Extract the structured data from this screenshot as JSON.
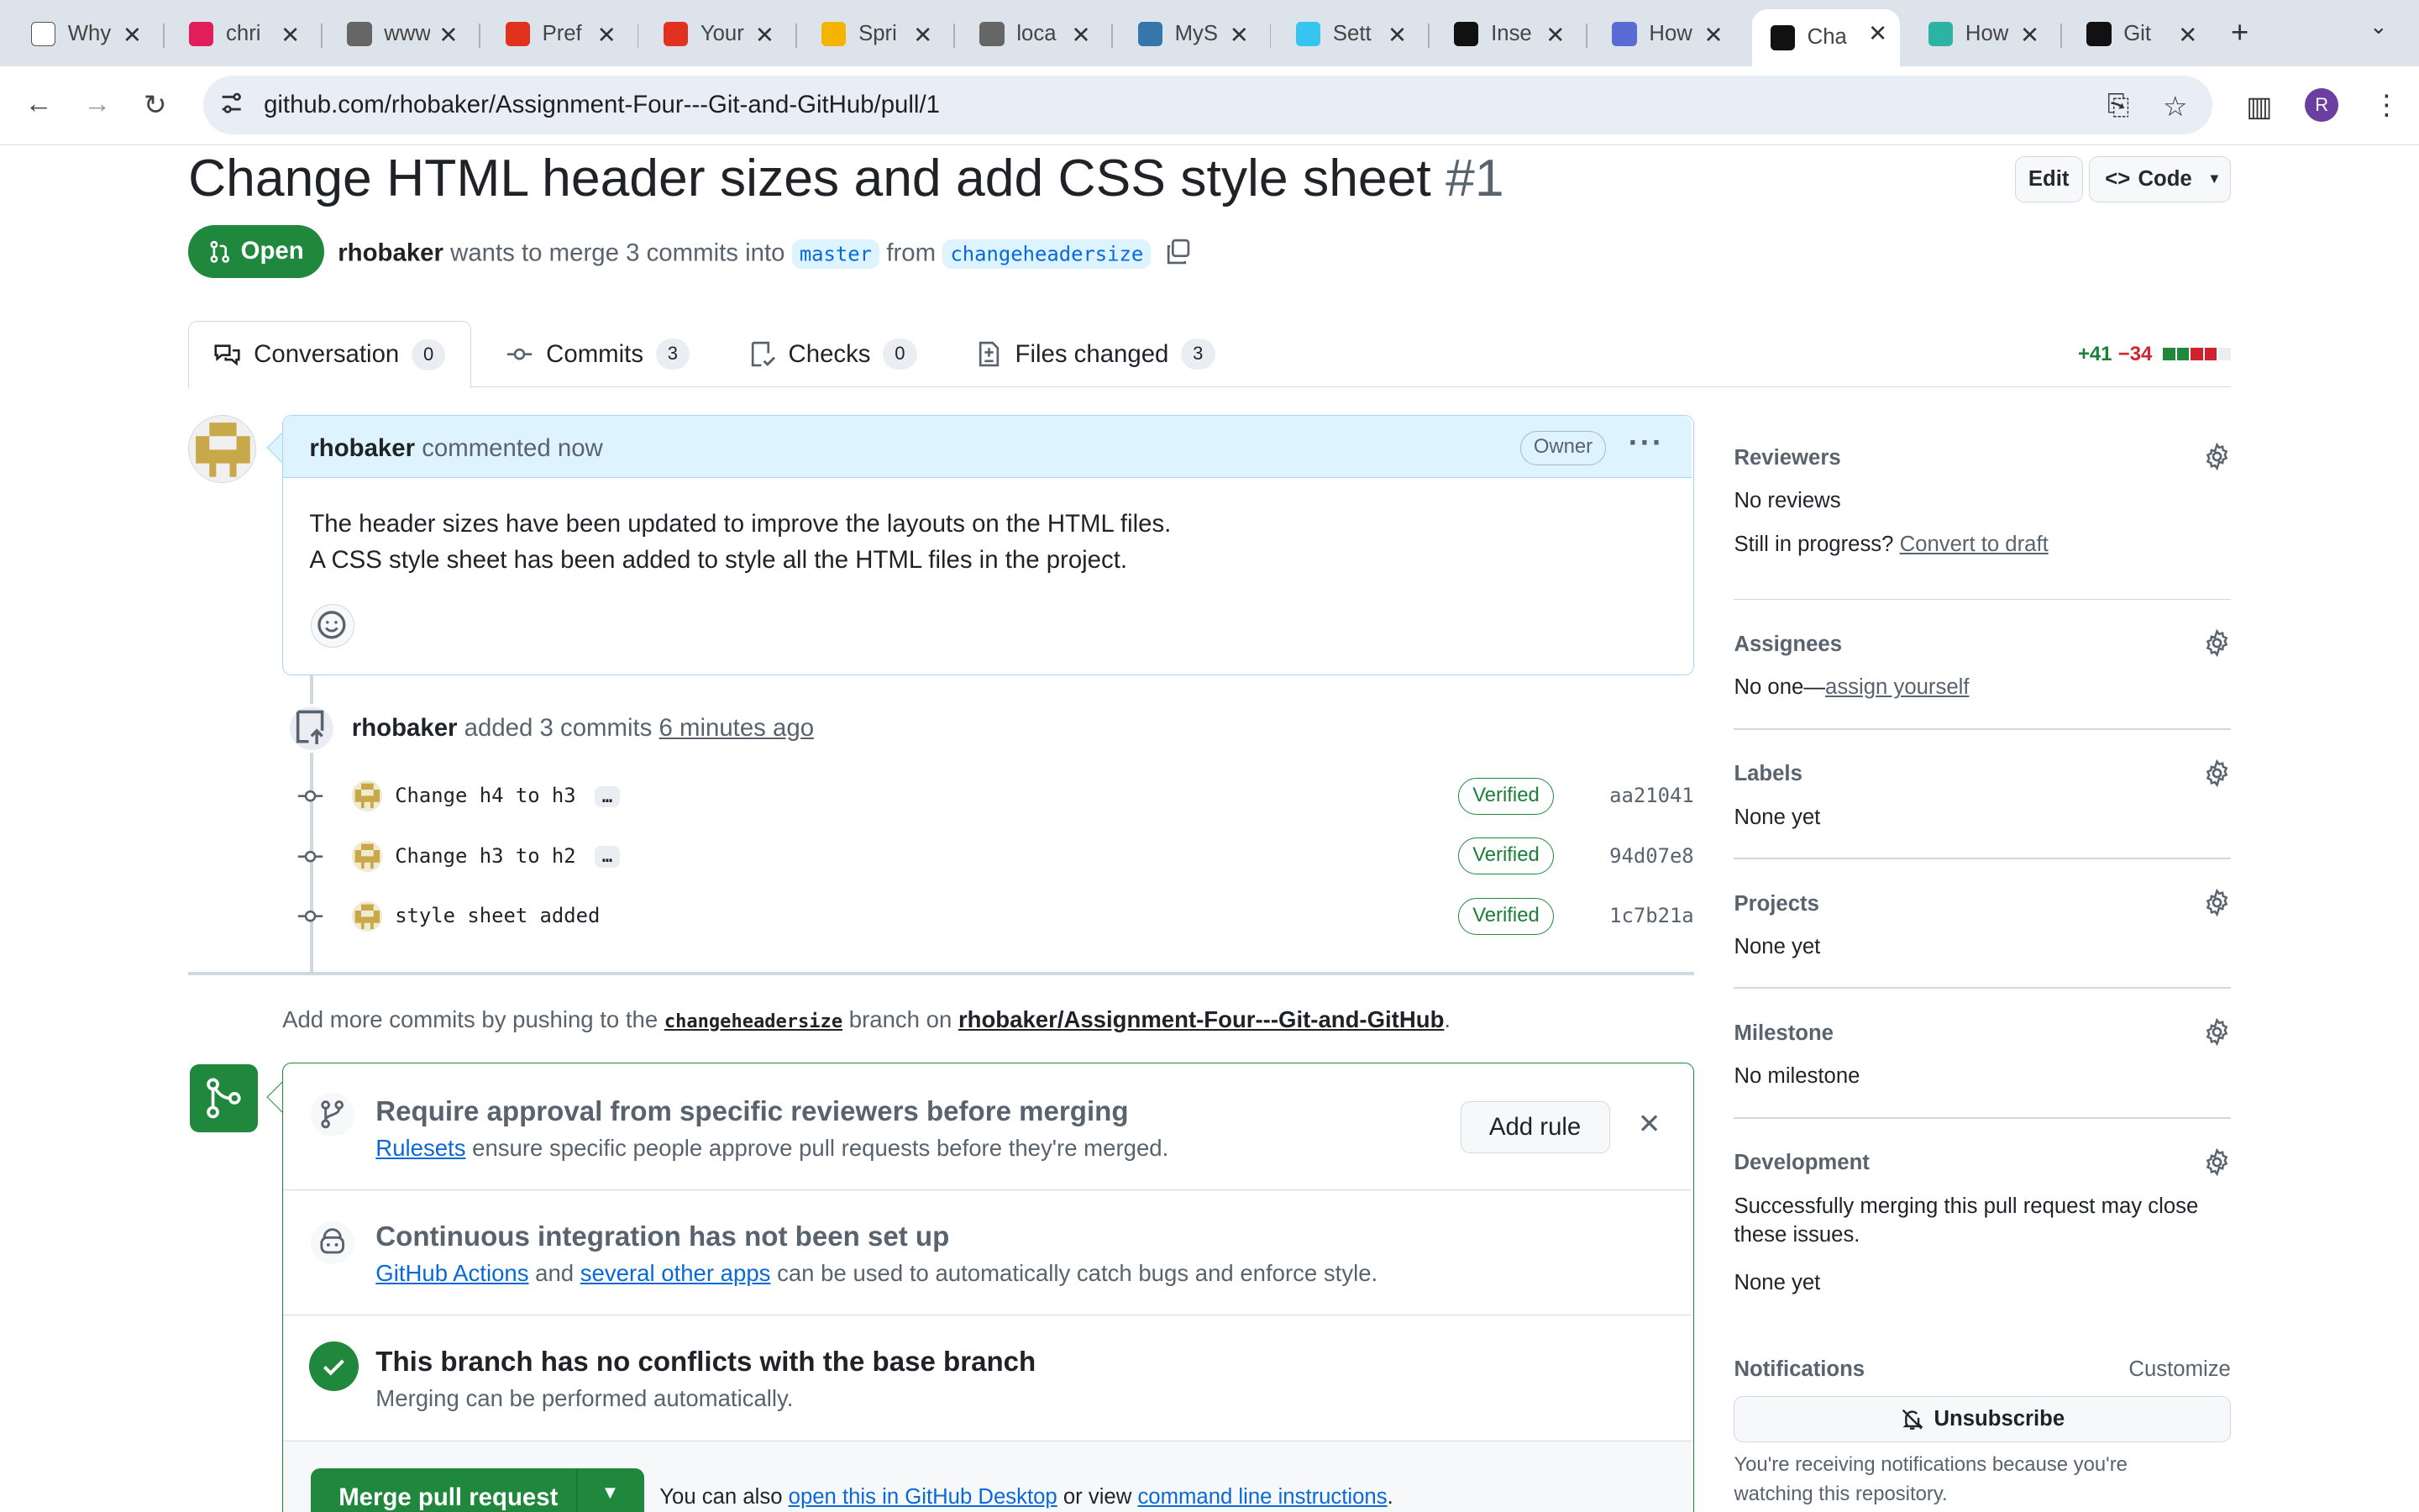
{
  "browser": {
    "tabs": [
      {
        "title": "Why",
        "color": "#ffffff"
      },
      {
        "title": "chri",
        "color": "#e01e5a"
      },
      {
        "title": "www",
        "color": "#666666"
      },
      {
        "title": "Pref",
        "color": "#e0321f"
      },
      {
        "title": "Your",
        "color": "#e0321f"
      },
      {
        "title": "Spri",
        "color": "#f5b400"
      },
      {
        "title": "loca",
        "color": "#666666"
      },
      {
        "title": "MyS",
        "color": "#3776ab"
      },
      {
        "title": "Sett",
        "color": "#36c5f0"
      },
      {
        "title": "Inse",
        "color": "#111111"
      },
      {
        "title": "How",
        "color": "#5b6bd6"
      },
      {
        "title": "Cha",
        "color": "#111111"
      },
      {
        "title": "How",
        "color": "#2db3a3"
      },
      {
        "title": "Git",
        "color": "#111111"
      }
    ],
    "active_tab": 11,
    "url_host": "github.com",
    "url_path": "/rhobaker/Assignment-Four---Git-and-GitHub/pull/1",
    "profile_initial": "R"
  },
  "pr": {
    "title": "Change HTML header sizes and add CSS style sheet",
    "number": "#1",
    "edit_label": "Edit",
    "code_label": "Code",
    "state": "Open",
    "author": "rhobaker",
    "merge_text": "wants to merge 3 commits into",
    "base": "master",
    "from_text": "from",
    "head": "changeheadersize"
  },
  "tabs": [
    {
      "label": "Conversation",
      "count": "0"
    },
    {
      "label": "Commits",
      "count": "3"
    },
    {
      "label": "Checks",
      "count": "0"
    },
    {
      "label": "Files changed",
      "count": "3"
    }
  ],
  "diffstat": {
    "additions": "+41",
    "deletions": "−34"
  },
  "comment": {
    "author": "rhobaker",
    "action": "commented now",
    "badge": "Owner",
    "line1": "The header sizes have been updated to improve the layouts on the HTML files.",
    "line2": "A CSS style sheet has been added to style all the HTML files in the project."
  },
  "event": {
    "author": "rhobaker",
    "action": "added 3 commits",
    "time": "6 minutes ago"
  },
  "commits": [
    {
      "message": "Change h4 to h3",
      "more": "…",
      "verified": "Verified",
      "sha": "aa21041"
    },
    {
      "message": "Change h3 to h2",
      "more": "…",
      "verified": "Verified",
      "sha": "94d07e8"
    },
    {
      "message": "style sheet added",
      "more": "",
      "verified": "Verified",
      "sha": "1c7b21a"
    }
  ],
  "addmore": {
    "prefix": "Add more commits by pushing to the",
    "branch": "changeheadersize",
    "mid": "branch on",
    "repo": "rhobaker/Assignment-Four---Git-and-GitHub",
    "end": "."
  },
  "merge": {
    "rules_title": "Require approval from specific reviewers before merging",
    "rules_link": "Rulesets",
    "rules_text": "ensure specific people approve pull requests before they're merged.",
    "add_rule": "Add rule",
    "ci_title": "Continuous integration has not been set up",
    "ci_link1": "GitHub Actions",
    "ci_and": "and",
    "ci_link2": "several other apps",
    "ci_text": "can be used to automatically catch bugs and enforce style.",
    "ok_title": "This branch has no conflicts with the base branch",
    "ok_text": "Merging can be performed automatically.",
    "button": "Merge pull request",
    "also": "You can also",
    "desktop_link": "open this in GitHub Desktop",
    "or_view": "or view",
    "cli_link": "command line instructions",
    "end": "."
  },
  "sidebar": {
    "reviewers": {
      "heading": "Reviewers",
      "value": "No reviews",
      "progress": "Still in progress?",
      "draft_link": "Convert to draft"
    },
    "assignees": {
      "heading": "Assignees",
      "value": "No one—",
      "assign_link": "assign yourself"
    },
    "labels": {
      "heading": "Labels",
      "value": "None yet"
    },
    "projects": {
      "heading": "Projects",
      "value": "None yet"
    },
    "milestone": {
      "heading": "Milestone",
      "value": "No milestone"
    },
    "development": {
      "heading": "Development",
      "line1": "Successfully merging this pull request may close",
      "line2": "these issues.",
      "value": "None yet"
    },
    "notifications": {
      "heading": "Notifications",
      "customize": "Customize",
      "button": "Unsubscribe",
      "line1": "You're receiving notifications because you're",
      "line2": "watching this repository."
    }
  }
}
